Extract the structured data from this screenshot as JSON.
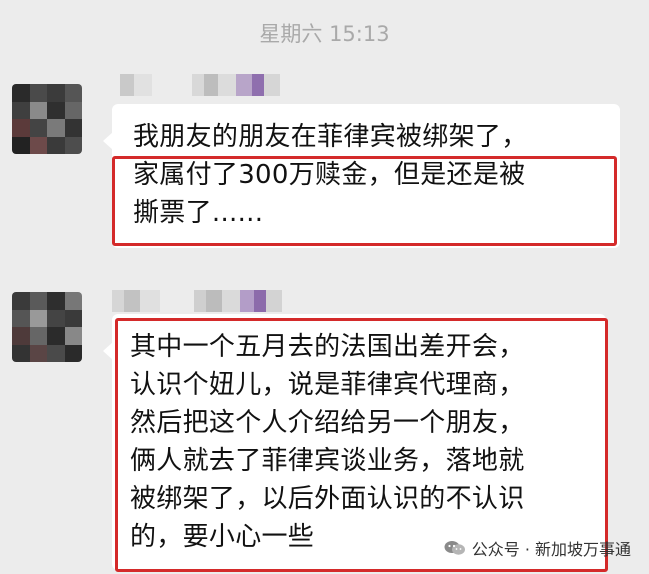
{
  "chat": {
    "timestamp": "星期六 15:13",
    "messages": [
      {
        "sender": "blurred",
        "lines": [
          "我朋友的朋友在菲律宾被绑架了，",
          "家属付了300万赎金，但是还是被",
          "撕票了......"
        ]
      },
      {
        "sender": "blurred",
        "lines": [
          "其中一个五月去的法国出差开会，",
          "认识个妞儿，说是菲律宾代理商，",
          "然后把这个人介绍给另一个朋友，",
          "俩人就去了菲律宾谈业务，落地就",
          "被绑架了，以后外面认识的不认识",
          "的，要小心一些"
        ]
      }
    ]
  },
  "watermark": {
    "text": "公众号 · 新加坡万事通",
    "icon": "wechat-official-account-icon"
  },
  "colors": {
    "background": "#ececec",
    "bubble": "#ffffff",
    "highlight": "#d42a2a",
    "timestamp": "#a9a9a9"
  }
}
